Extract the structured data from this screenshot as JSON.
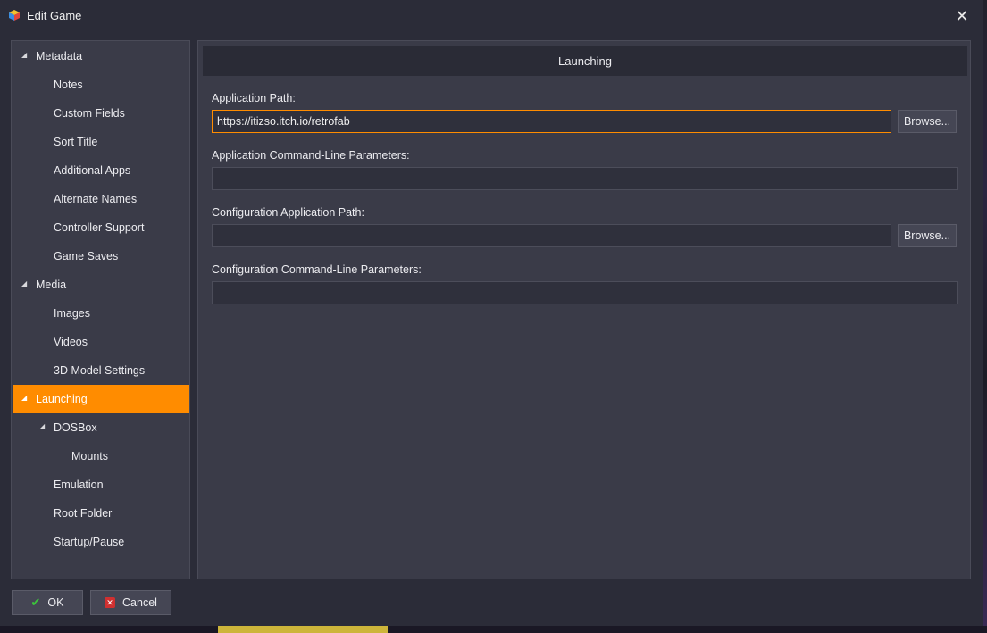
{
  "window": {
    "title": "Edit Game",
    "close_glyph": "✕"
  },
  "tree": {
    "items": [
      {
        "label": "Metadata",
        "expanded": true
      },
      {
        "label": "Notes"
      },
      {
        "label": "Custom Fields"
      },
      {
        "label": "Sort Title"
      },
      {
        "label": "Additional Apps"
      },
      {
        "label": "Alternate Names"
      },
      {
        "label": "Controller Support"
      },
      {
        "label": "Game Saves"
      },
      {
        "label": "Media",
        "expanded": true
      },
      {
        "label": "Images"
      },
      {
        "label": "Videos"
      },
      {
        "label": "3D Model Settings"
      },
      {
        "label": "Launching",
        "expanded": true,
        "selected": true
      },
      {
        "label": "DOSBox",
        "expanded": true
      },
      {
        "label": "Mounts"
      },
      {
        "label": "Emulation"
      },
      {
        "label": "Root Folder"
      },
      {
        "label": "Startup/Pause"
      }
    ]
  },
  "panel": {
    "header": "Launching",
    "app_path_label": "Application Path:",
    "app_path_value": "https://itizso.itch.io/retrofab",
    "app_params_label": "Application Command-Line Parameters:",
    "app_params_value": "",
    "config_path_label": "Configuration Application Path:",
    "config_path_value": "",
    "config_params_label": "Configuration Command-Line Parameters:",
    "config_params_value": "",
    "browse_label": "Browse..."
  },
  "buttons": {
    "ok_label": "OK",
    "cancel_label": "Cancel"
  },
  "colors": {
    "accent": "#ff8c00",
    "background": "#2b2c38",
    "panel": "#3a3b48"
  },
  "icons": {
    "arrow": "expanded-arrow-icon",
    "ok": "checkmark-icon",
    "cancel": "cancel-icon"
  }
}
